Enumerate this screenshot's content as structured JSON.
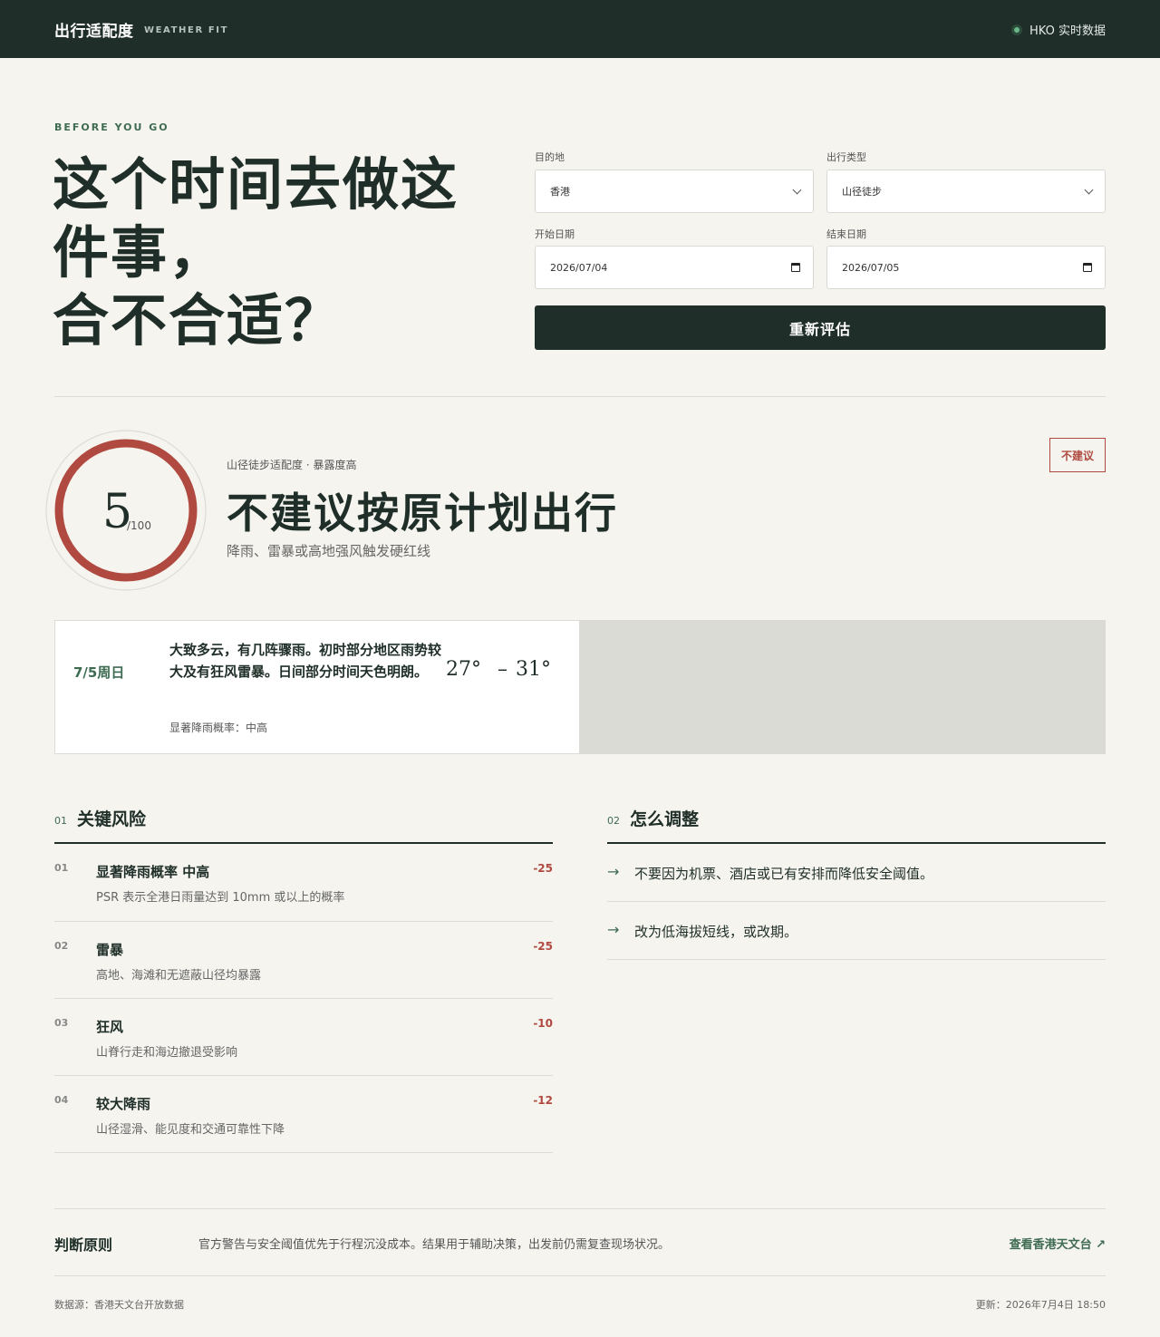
{
  "header": {
    "brand": "出行适配度",
    "brand_sub": "WEATHER FIT",
    "status_label": "HKO 实时数据"
  },
  "hero": {
    "eyebrow": "BEFORE YOU GO",
    "title_lines": [
      "这个时间去做这",
      "件事，",
      "合不合适？"
    ]
  },
  "form": {
    "destination_label": "目的地",
    "destination_value": "香港",
    "trip_type_label": "出行类型",
    "trip_type_value": "山径徒步",
    "start_label": "开始日期",
    "start_value": "2026/07/04",
    "end_label": "结束日期",
    "end_value": "2026/07/05",
    "submit_label": "重新评估"
  },
  "score": {
    "value": "5",
    "denominator": "/100",
    "fraction": 0.05,
    "ring_color": "#b04a40",
    "meta": "山径徒步适配度 · 暴露度高",
    "verdict": "不建议按原计划出行",
    "reason": "降雨、雷暴或高地强风触发硬红线",
    "badge": "不建议"
  },
  "forecast": {
    "date": "7/5周日",
    "description": "大致多云，有几阵骤雨。初时部分地区雨势较大及有狂风雷暴。日间部分时间天色明朗。",
    "psr": "显著降雨概率：中高",
    "temp_min": "27°",
    "temp_sep": "–",
    "temp_max": "31°"
  },
  "risks": {
    "num": "01",
    "title": "关键风险",
    "items": [
      {
        "idx": "01",
        "title": "显著降雨概率 中高",
        "desc": "PSR 表示全港日雨量达到 10mm 或以上的概率",
        "delta": "-25"
      },
      {
        "idx": "02",
        "title": "雷暴",
        "desc": "高地、海滩和无遮蔽山径均暴露",
        "delta": "-25"
      },
      {
        "idx": "03",
        "title": "狂风",
        "desc": "山脊行走和海边撤退受影响",
        "delta": "-10"
      },
      {
        "idx": "04",
        "title": "较大降雨",
        "desc": "山径湿滑、能见度和交通可靠性下降",
        "delta": "-12"
      }
    ]
  },
  "adjust": {
    "num": "02",
    "title": "怎么调整",
    "arrow": "→",
    "items": [
      "不要因为机票、酒店或已有安排而降低安全阈值。",
      "改为低海拔短线，或改期。"
    ]
  },
  "principle": {
    "title": "判断原则",
    "text": "官方警告与安全阈值优先于行程沉没成本。结果用于辅助决策，出发前仍需复查现场状况。",
    "link": "查看香港天文台 ↗"
  },
  "footer": {
    "source": "数据源：香港天文台开放数据",
    "updated": "更新：2026年7月4日 18:50"
  }
}
